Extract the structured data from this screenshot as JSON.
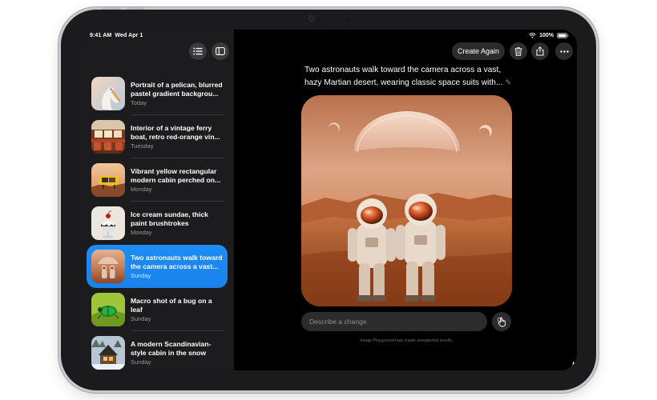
{
  "status": {
    "time": "9:41 AM",
    "date": "Wed Apr 1",
    "battery": "100%"
  },
  "sidebar": {
    "list_button": "list-icon",
    "sidebar_button": "sidebar-icon",
    "new_button": "plus-icon",
    "items": [
      {
        "title": "Portrait of a pelican, blurred pastel gradient backgrou...",
        "date": "Today",
        "thumb": "pelican"
      },
      {
        "title": "Interior of a vintage ferry boat, retro red-orange vin...",
        "date": "Tuesday",
        "thumb": "ferry"
      },
      {
        "title": "Vibrant yellow rectangular modern cabin perched on...",
        "date": "Monday",
        "thumb": "cabin"
      },
      {
        "title": "Ice cream sundae, thick paint brushtrokes",
        "date": "Monday",
        "thumb": "sundae"
      },
      {
        "title": "Two astronauts walk toward the camera across a vast...",
        "date": "Sunday",
        "thumb": "astronauts",
        "selected": true
      },
      {
        "title": "Macro shot of a bug on a leaf",
        "date": "Sunday",
        "thumb": "bug"
      },
      {
        "title": "A modern Scandinavian-style cabin in the snow",
        "date": "Sunday",
        "thumb": "snowcabin"
      }
    ]
  },
  "toolbar": {
    "create_again": "Create Again",
    "delete_icon": "trash-icon",
    "share_icon": "share-icon",
    "more_icon": "ellipsis-icon"
  },
  "main": {
    "prompt": "Two astronauts walk toward the camera across a vast, hazy Martian desert, wearing classic space suits with...",
    "image_subject": "astronauts-on-mars",
    "describe_placeholder": "Describe a change",
    "disclaimer": "Image Playground may create unexpected results."
  },
  "colors": {
    "accent": "#0a84ff",
    "background": "#000000",
    "sidebar": "#1c1c1e",
    "control": "#2c2c2e"
  }
}
